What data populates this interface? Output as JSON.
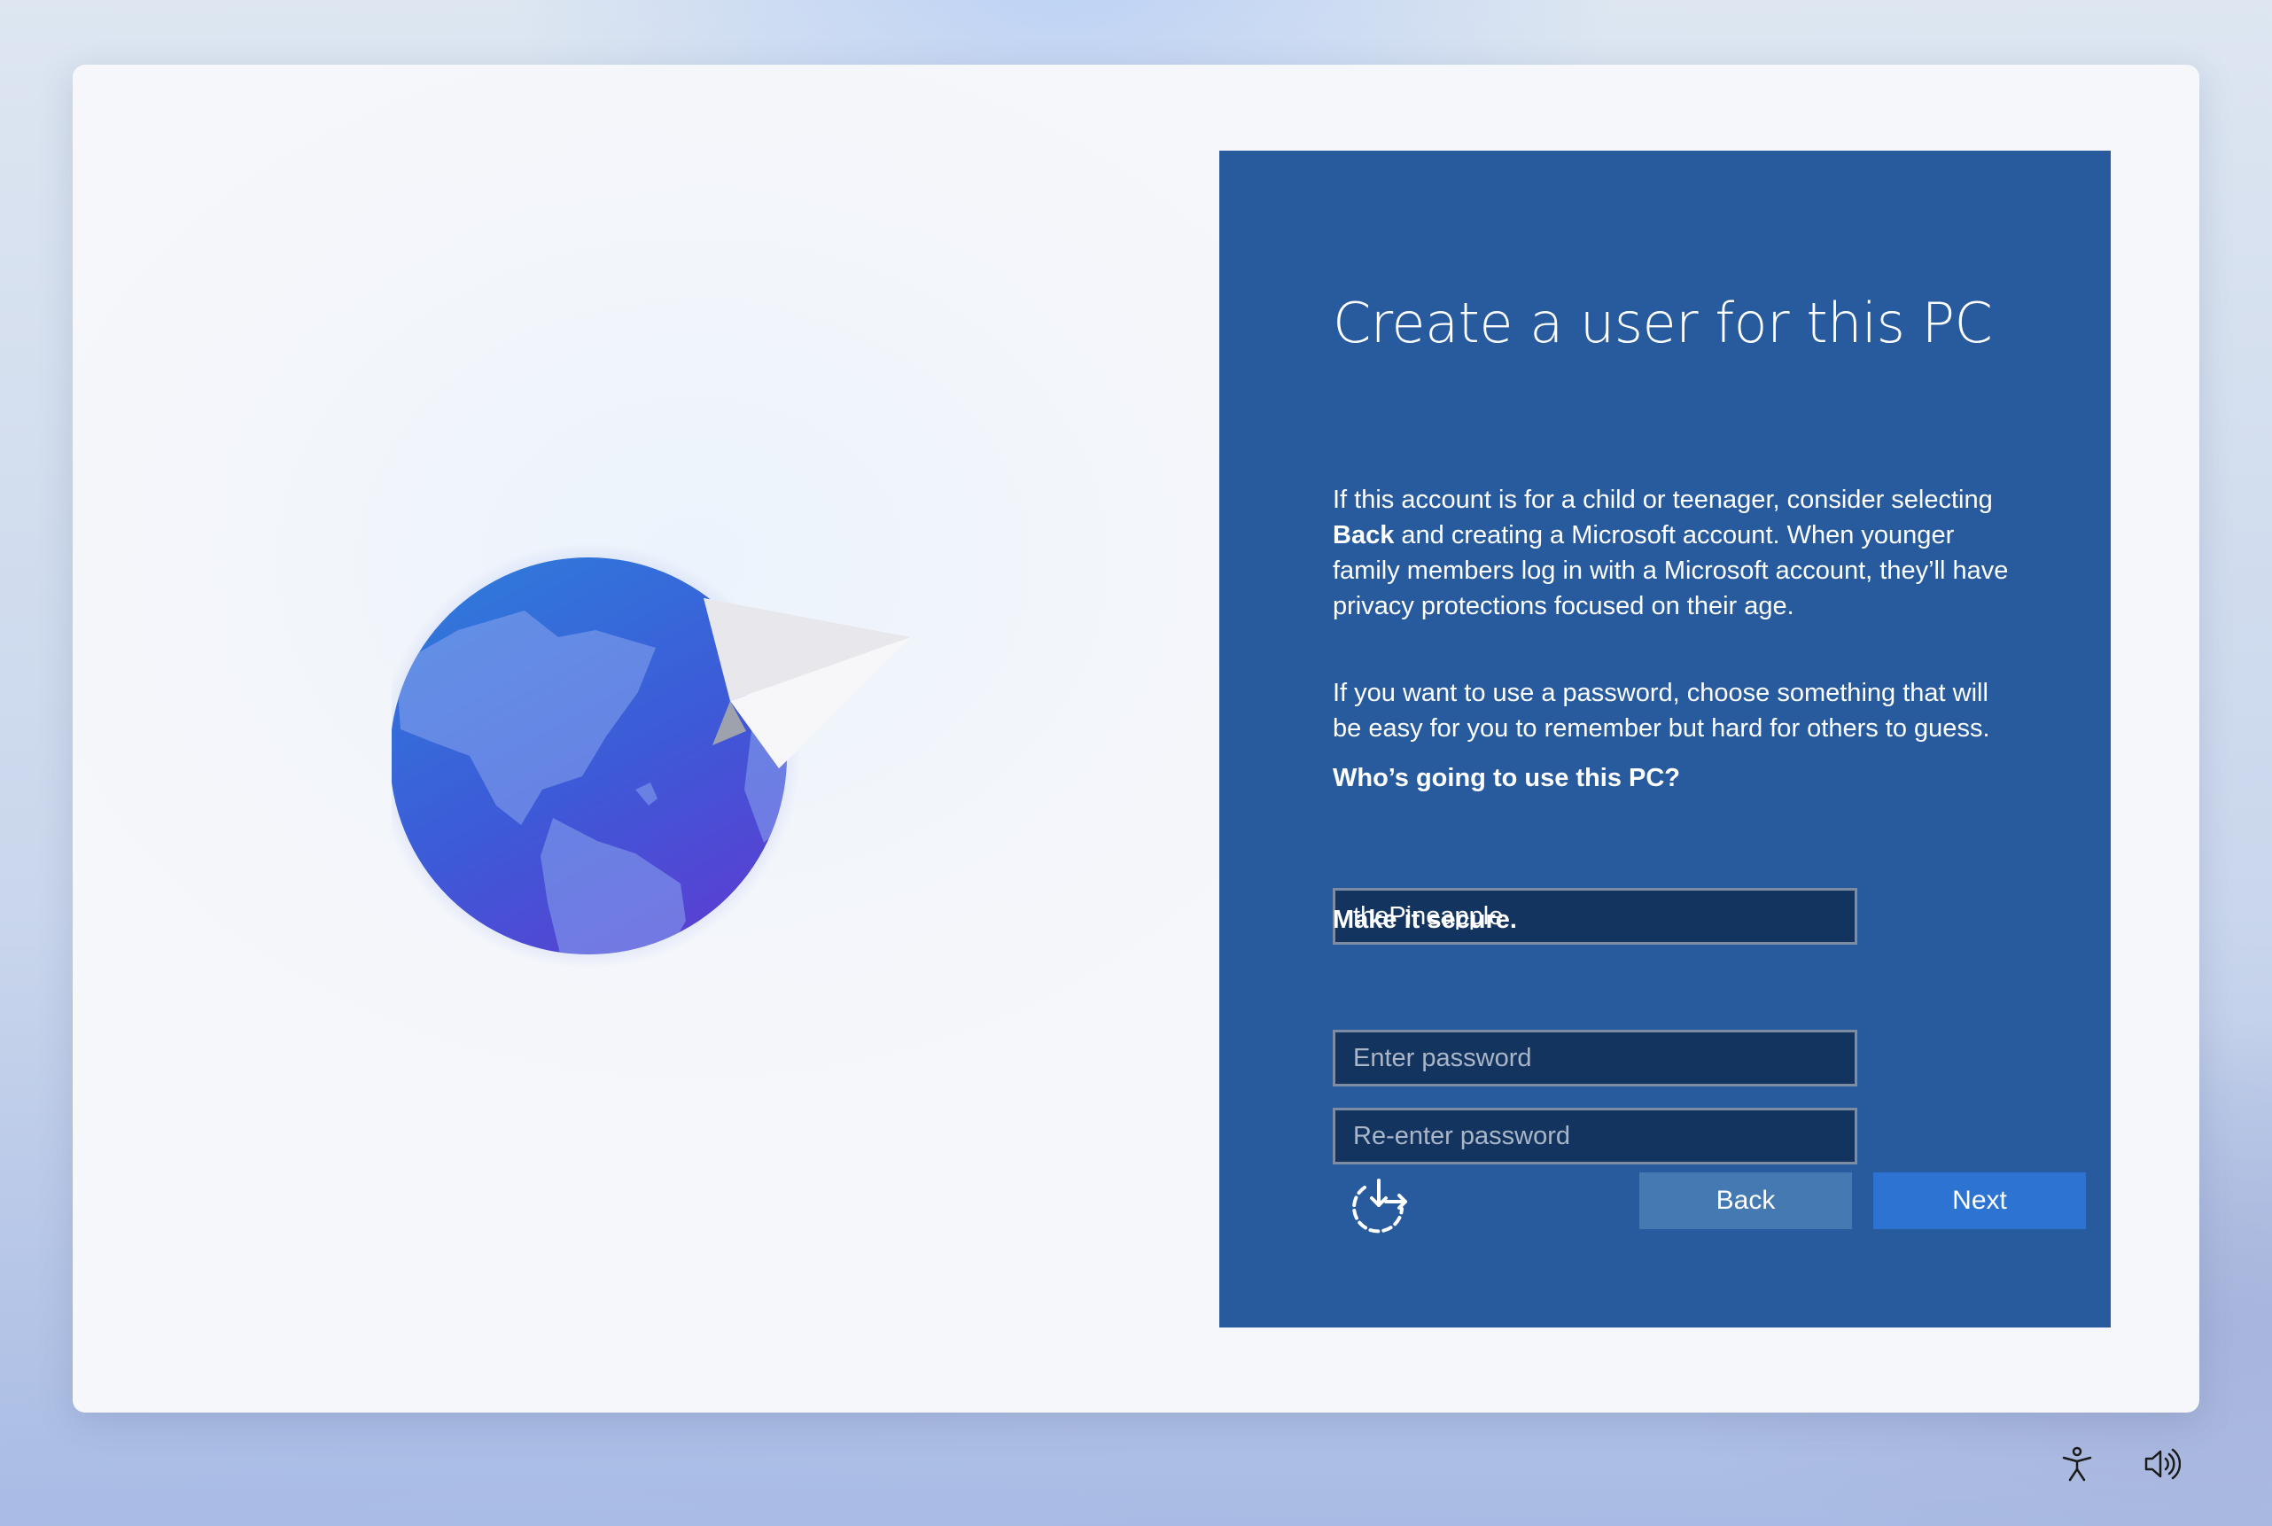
{
  "setup": {
    "title": "Create a user for this PC",
    "paragraph1": {
      "part1": "If this account is for a child or teenager, consider selecting ",
      "bold": "Back",
      "part2": " and creating a Microsoft account. When younger family members log in with a Microsoft account, they’ll have privacy protections focused on their age."
    },
    "paragraph2": "If you want to use a password, choose something that will be easy for you to remember but hard for others to guess.",
    "user_label": "Who’s going to use this PC?",
    "user_value": "thePineapple",
    "secure_label": "Make it secure.",
    "password_placeholder": "Enter password",
    "reenter_placeholder": "Re-enter password",
    "back_label": "Back",
    "next_label": "Next"
  },
  "icons": {
    "illustration": "globe-paper-plane-illustration",
    "restart": "restart-setup-icon",
    "accessibility": "accessibility-icon",
    "volume": "volume-icon"
  },
  "colors": {
    "panel": "#275b9d",
    "input_bg": "#143460",
    "back_button": "#4579b1",
    "next_button": "#2d74d2"
  }
}
